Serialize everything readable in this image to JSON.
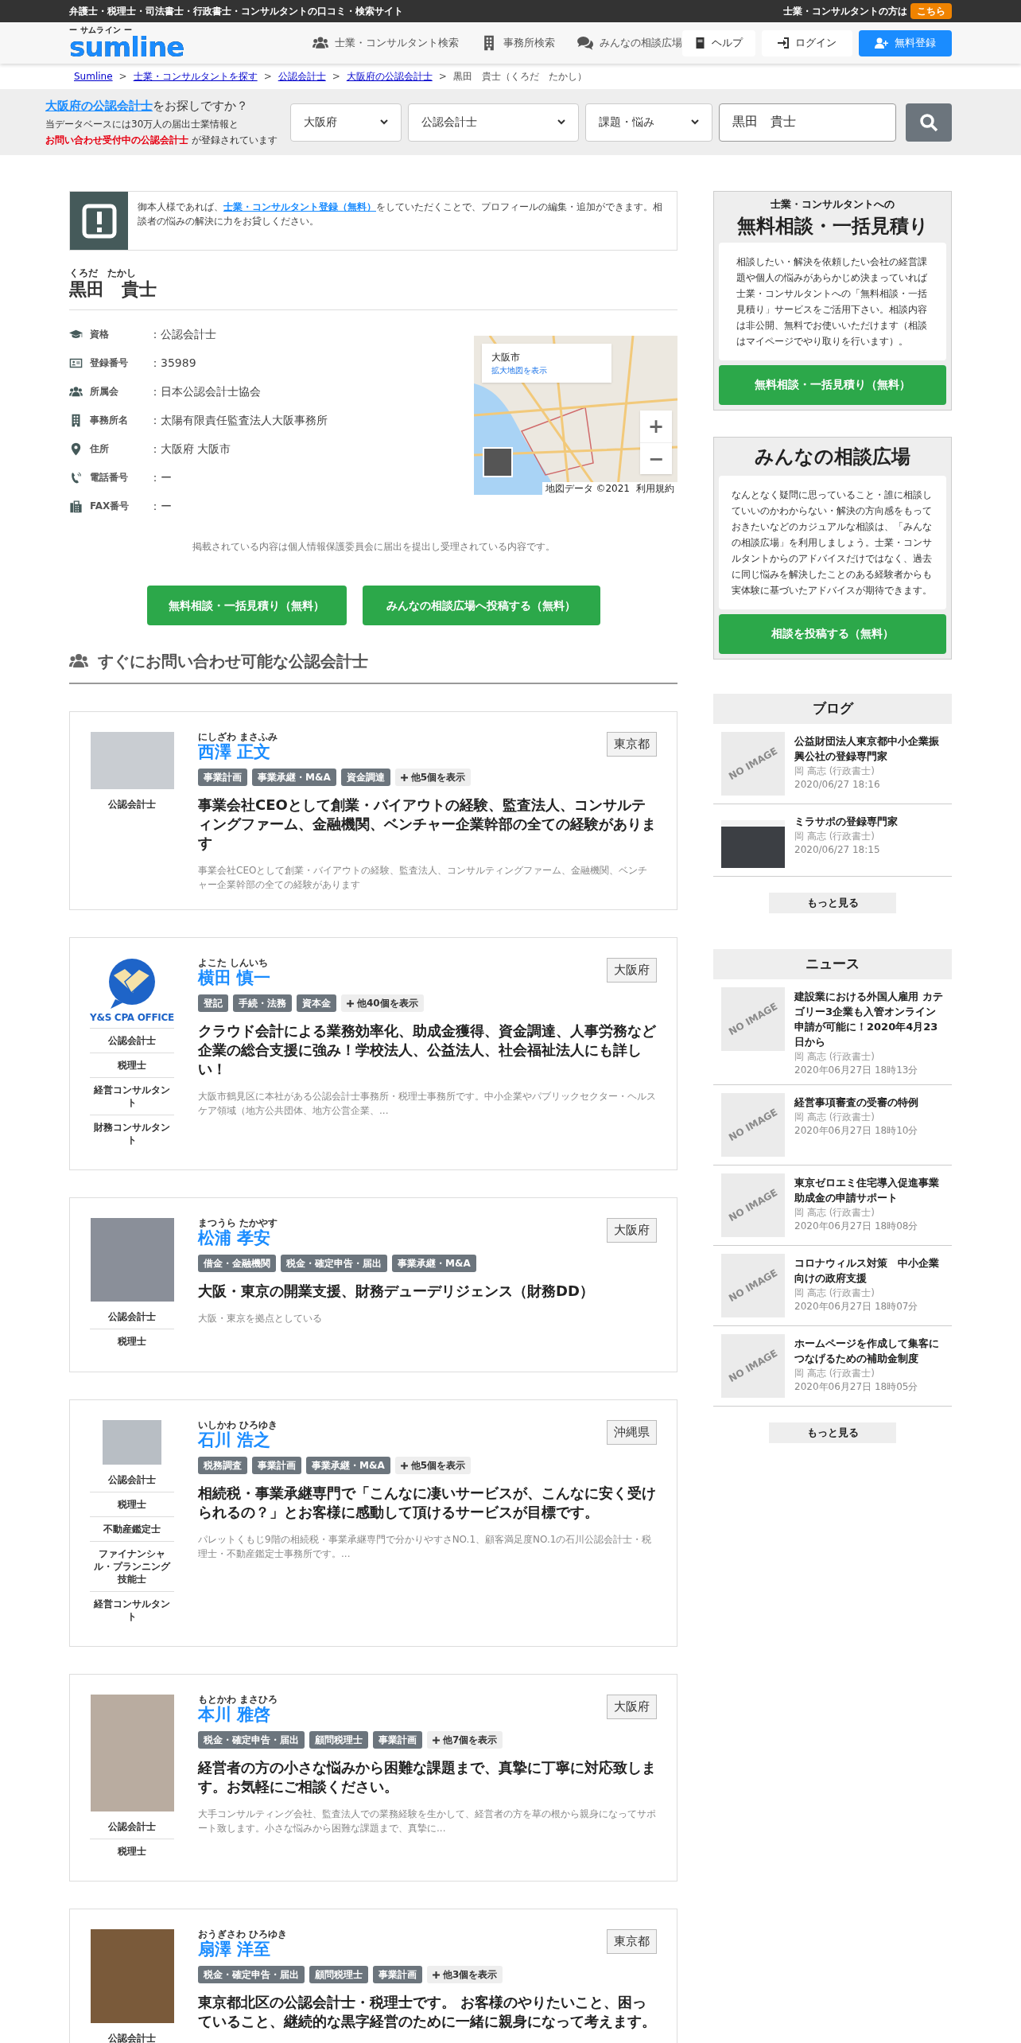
{
  "top_bar": {
    "tagline": "弁護士・税理士・司法書士・行政書士・コンサルタントの口コミ・検索サイト",
    "pro_prompt": "士業・コンサルタントの方は",
    "pro_link": "こちら"
  },
  "header": {
    "logo_reading": "ー サムライン ー",
    "logo": "sumline",
    "nav": [
      {
        "label": "士業・コンサルタント検索"
      },
      {
        "label": "事務所検索"
      },
      {
        "label": "みんなの相談広場"
      }
    ],
    "help": "ヘルプ",
    "login": "ログイン",
    "register": "無料登録"
  },
  "breadcrumb": [
    {
      "label": "Sumline",
      "link": true
    },
    {
      "separator": ">",
      "label": "士業・コンサルタントを探す",
      "link": true
    },
    {
      "separator": ">",
      "label": "公認会計士",
      "link": true
    },
    {
      "separator": ">",
      "label": "大阪府の公認会計士",
      "link": true
    },
    {
      "separator": ">",
      "label": "黒田　貴士（くろだ　たかし）",
      "link": false
    }
  ],
  "search": {
    "headline_link": "大阪府の公認会計士",
    "headline_rest": "をお探しですか？",
    "line1": "当データベースには30万人の届出士業情報と",
    "line2_highlight": "お問い合わせ受付中の公認会計士",
    "line2_rest": "が登録されています",
    "selects": [
      "大阪府",
      "公認会計士",
      "課題・悩み"
    ],
    "keyword": "黒田　貴士"
  },
  "notice": {
    "before": "御本人様であれば、",
    "link": "士業・コンサルタント登録（無料）",
    "after": "をしていただくことで、プロフィールの編集・追加ができます。相談者の悩みの解決に力をお貸しください。"
  },
  "profile": {
    "reading": "くろだ　たかし",
    "name": "黒田　貴士",
    "fields": [
      {
        "label": "資格",
        "value": "：公認会計士"
      },
      {
        "label": "登録番号",
        "value": "：35989"
      },
      {
        "label": "所属会",
        "value": "：日本公認会計士協会"
      },
      {
        "label": "事務所名",
        "value": "：太陽有限責任監査法人大阪事務所"
      },
      {
        "label": "住所",
        "value": "：大阪府 大阪市"
      },
      {
        "label": "電話番号",
        "value": "：ー"
      },
      {
        "label": "FAX番号",
        "value": "：ー"
      }
    ],
    "map": {
      "place": "大阪市",
      "link": "拡大地図を表示",
      "zoom_in": "+",
      "zoom_out": "−",
      "attribution": "地図データ ©2021",
      "terms": "利用規約"
    },
    "disclaimer": "掲載されている内容は個人情報保護委員会に届出を提出し受理されている内容です。",
    "actions": [
      "無料相談・一括見積り（無料）",
      "みんなの相談広場へ投稿する（無料）"
    ]
  },
  "section_title": "すぐにお問い合わせ可能な公認会計士",
  "cards": [
    {
      "reading": "にしざわ まさふみ",
      "name": "西澤 正文",
      "prefecture": "東京都",
      "kind": "photo",
      "tags": [
        "事業計画",
        "事業承継・M&A",
        "資金調達"
      ],
      "more": "他5個を表示",
      "title": "事業会社CEOとして創業・バイアウトの経験、監査法人、コンサルティングファーム、金融機関、ベンチャー企業幹部の全ての経験があります",
      "description": "事業会社CEOとして創業・バイアウトの経験、監査法人、コンサルティングファーム、金融機関、ベンチャー企業幹部の全ての経験があります",
      "qualifications": [
        "公認会計士"
      ]
    },
    {
      "reading": "よこた しんいち",
      "name": "横田 慎一",
      "prefecture": "大阪府",
      "kind": "logo",
      "logo_text": "Y&S CPA OFFICE",
      "tags": [
        "登記",
        "手続・法務",
        "資本金"
      ],
      "more": "他40個を表示",
      "title": "クラウド会計による業務効率化、助成金獲得、資金調達、人事労務など企業の総合支援に強み！学校法人、公益法人、社会福祉法人にも詳しい！",
      "description": "大阪市鶴見区に本社がある公認会計士事務所・税理士事務所です。中小企業やパブリックセクター・ヘルスケア領域（地方公共団体、地方公営企業、...",
      "qualifications": [
        "公認会計士",
        "税理士",
        "経営コンサルタント",
        "財務コンサルタント"
      ]
    },
    {
      "reading": "まつうら たかやす",
      "name": "松浦 孝安",
      "prefecture": "大阪府",
      "kind": "photo",
      "tags": [
        "借金・金融機関",
        "税金・確定申告・届出",
        "事業承継・M&A"
      ],
      "title": "大阪・東京の開業支援、財務デューデリジェンス（財務DD）",
      "description": "大阪・東京を拠点としている",
      "qualifications": [
        "公認会計士",
        "税理士"
      ]
    },
    {
      "reading": "いしかわ ひろゆき",
      "name": "石川 浩之",
      "prefecture": "沖縄県",
      "kind": "photo",
      "tags": [
        "税務調査",
        "事業計画",
        "事業承継・M&A"
      ],
      "more": "他5個を表示",
      "title": "相続税・事業承継専門で「こんなに凄いサービスが、こんなに安く受けられるの？」とお客様に感動して頂けるサービスが目標です。",
      "description": "パレットくもじ9階の相続税・事業承継専門で分かりやすさNO.1、顧客満足度NO.1の石川公認会計士・税理士・不動産鑑定士事務所です。...",
      "qualifications": [
        "公認会計士",
        "税理士",
        "不動産鑑定士",
        "ファイナンシャル・プランニング技能士",
        "経営コンサルタント"
      ]
    },
    {
      "reading": "もとかわ まさひろ",
      "name": "本川 雅啓",
      "prefecture": "大阪府",
      "kind": "photo",
      "tags": [
        "税金・確定申告・届出",
        "顧問税理士",
        "事業計画"
      ],
      "more": "他7個を表示",
      "title": "経営者の方の小さな悩みから困難な課題まで、真摯に丁寧に対応致します。お気軽にご相談ください。",
      "description": "大手コンサルティング会社、監査法人での業務経験を生かして、経営者の方を草の根から親身になってサポート致します。小さな悩みから困難な課題まで、真摯に...",
      "qualifications": [
        "公認会計士",
        "税理士"
      ]
    },
    {
      "reading": "おうぎさわ ひろゆき",
      "name": "扇澤 洋至",
      "prefecture": "東京都",
      "kind": "photo",
      "tags": [
        "税金・確定申告・届出",
        "顧問税理士",
        "事業計画"
      ],
      "more": "他3個を表示",
      "title": "東京都北区の公認会計士・税理士です。 お客様のやりたいこと、困っていること、継続的な黒字経営のために一緒に親身になって考えます。",
      "qualifications": [
        "公認会計士"
      ]
    }
  ],
  "sidebar": {
    "consult": {
      "subtitle": "士業・コンサルタントへの",
      "title": "無料相談・一括見積り",
      "body": "相談したい・解決を依頼したい会社の経営課題や個人の悩みがあらかじめ決まっていれば士業・コンサルタントへの「無料相談・一括見積り」サービスをご活用下さい。相談内容は非公開、無料でお使いいただけます（相談はマイページでやり取りを行います）。",
      "button": "無料相談・一括見積り（無料）"
    },
    "forum": {
      "title": "みんなの相談広場",
      "body": "なんとなく疑問に思っていること・誰に相談していいのかわからない・解決の方向感をもっておきたいなどのカジュアルな相談は、「みんなの相談広場」を利用しましょう。士業・コンサルタントからのアドバイスだけではなく、過去に同じ悩みを解決したことのある経験者からも実体験に基づいたアドバイスが期待できます。",
      "button": "相談を投稿する（無料）"
    },
    "lists": [
      {
        "title": "ブログ",
        "items": [
          {
            "thumb": {
              "kind": "none",
              "text": "NO IMAGE"
            },
            "title": "公益財団法人東京都中小企業振興公社の登録専門家",
            "author": "岡 高志 (行政書士)",
            "date": "2020/06/27 18:16"
          },
          {
            "thumb": {
              "kind": "photo"
            },
            "title": "ミラサポの登録専門家",
            "author": "岡 高志 (行政書士)",
            "date": "2020/06/27 18:15"
          }
        ],
        "more": "もっと見る"
      },
      {
        "title": "ニュース",
        "items": [
          {
            "thumb": {
              "kind": "none",
              "text": "NO IMAGE"
            },
            "title": "建設業における外国人雇用 カテゴリー3企業も入管オンライン申請が可能に！2020年4月23日から",
            "author": "岡 高志 (行政書士)",
            "date": "2020年06月27日 18時13分"
          },
          {
            "thumb": {
              "kind": "none",
              "text": "NO IMAGE"
            },
            "title": "経営事項審査の受審の特例",
            "author": "岡 高志 (行政書士)",
            "date": "2020年06月27日 18時10分"
          },
          {
            "thumb": {
              "kind": "none",
              "text": "NO IMAGE"
            },
            "title": "東京ゼロエミ住宅導入促進事業助成金の申請サポート",
            "author": "岡 高志 (行政書士)",
            "date": "2020年06月27日 18時08分"
          },
          {
            "thumb": {
              "kind": "none",
              "text": "NO IMAGE"
            },
            "title": "コロナウィルス対策　中小企業向けの政府支援",
            "author": "岡 高志 (行政書士)",
            "date": "2020年06月27日 18時07分"
          },
          {
            "thumb": {
              "kind": "none",
              "text": "NO IMAGE"
            },
            "title": "ホームページを作成して集客につなげるための補助金制度",
            "author": "岡 高志 (行政書士)",
            "date": "2020年06月27日 18時05分"
          }
        ],
        "more": "もっと見る"
      }
    ]
  }
}
